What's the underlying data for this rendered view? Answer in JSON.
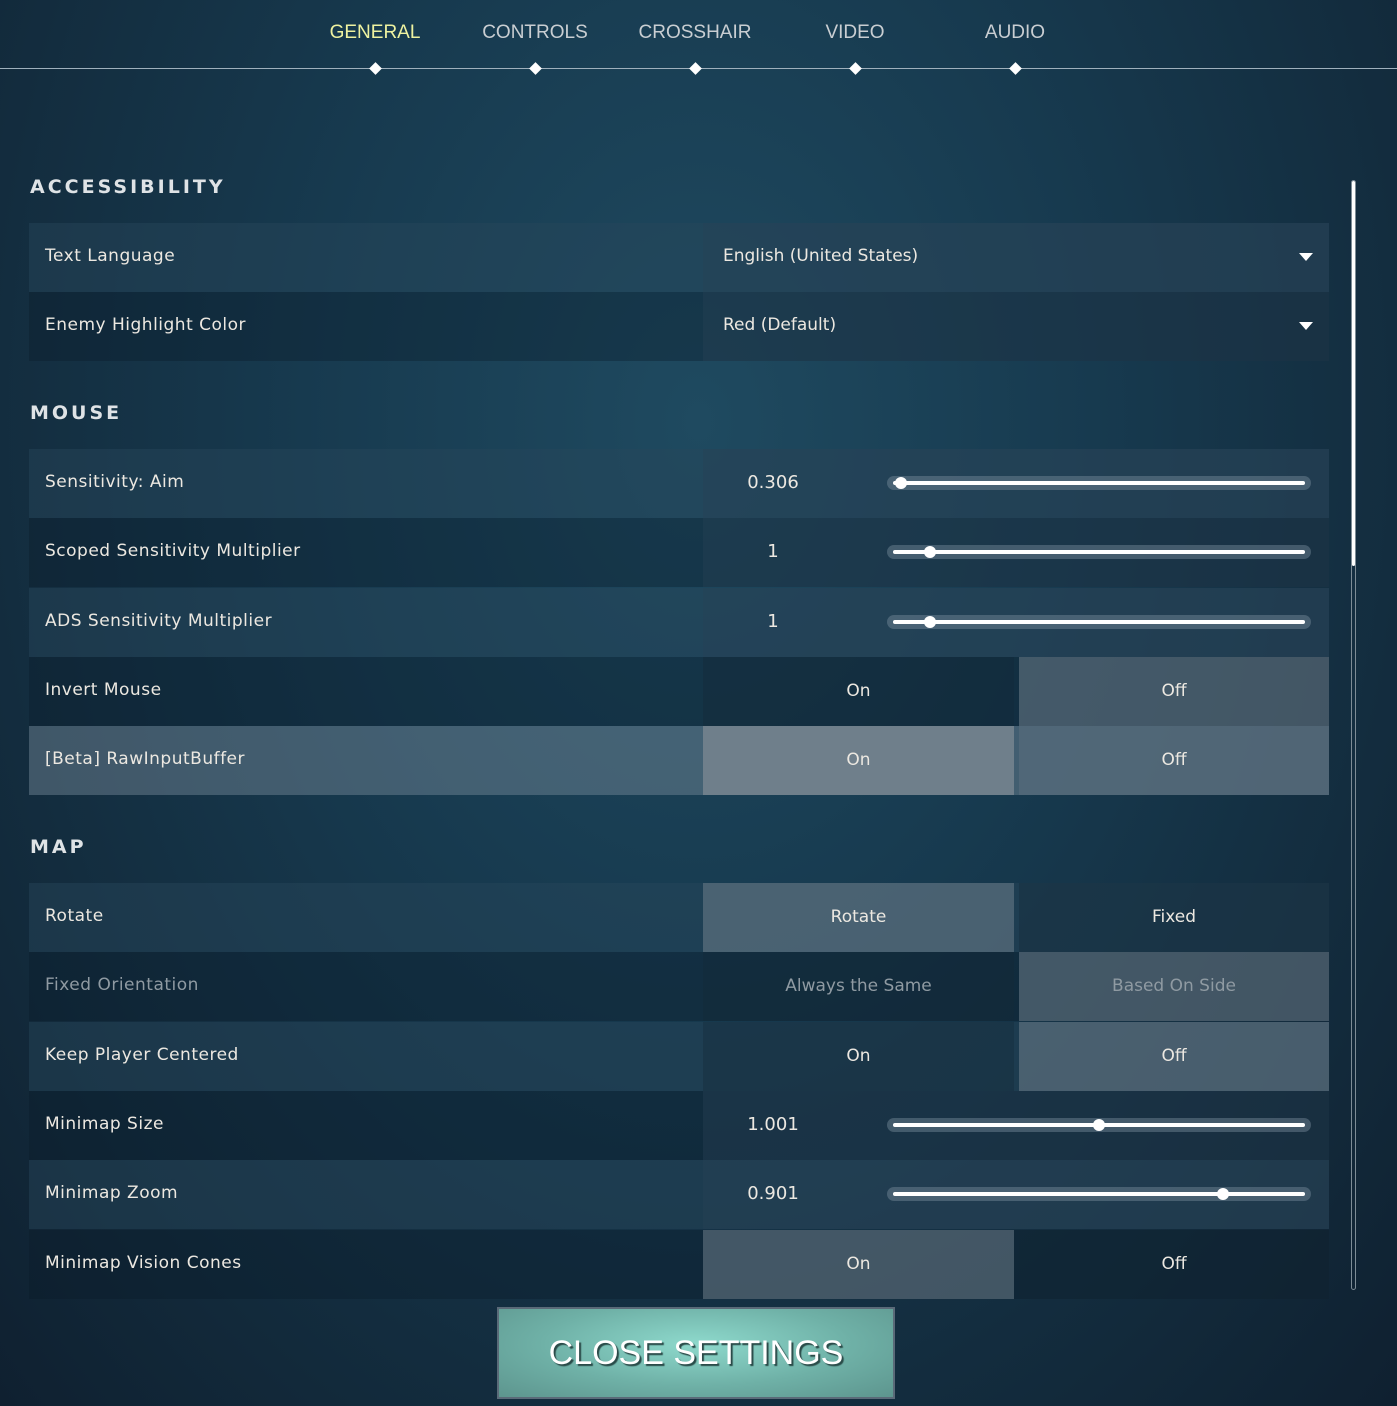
{
  "tabs": [
    "GENERAL",
    "CONTROLS",
    "CROSSHAIR",
    "VIDEO",
    "AUDIO"
  ],
  "active_tab": "GENERAL",
  "sections": [
    {
      "title": "ACCESSIBILITY",
      "rows": [
        {
          "label": "Text Language",
          "type": "dropdown",
          "value": "English (United States)"
        },
        {
          "label": "Enemy Highlight Color",
          "type": "dropdown",
          "value": "Red (Default)"
        }
      ]
    },
    {
      "title": "MOUSE",
      "rows": [
        {
          "label": "Sensitivity: Aim",
          "type": "slider",
          "value": "0.306",
          "fill_percent": 2
        },
        {
          "label": "Scoped Sensitivity Multiplier",
          "type": "slider",
          "value": "1",
          "fill_percent": 9
        },
        {
          "label": "ADS Sensitivity Multiplier",
          "type": "slider",
          "value": "1",
          "fill_percent": 9
        },
        {
          "label": "Invert Mouse",
          "type": "toggle",
          "options": [
            "On",
            "Off"
          ],
          "selected": "Off"
        },
        {
          "label": "[Beta] RawInputBuffer",
          "type": "toggle",
          "options": [
            "On",
            "Off"
          ],
          "selected": "On",
          "hovered": true
        }
      ]
    },
    {
      "title": "MAP",
      "rows": [
        {
          "label": "Rotate",
          "type": "toggle",
          "options": [
            "Rotate",
            "Fixed"
          ],
          "selected": "Rotate"
        },
        {
          "label": "Fixed Orientation",
          "type": "toggle",
          "options": [
            "Always the Same",
            "Based On Side"
          ],
          "selected": "Based On Side",
          "disabled": true
        },
        {
          "label": "Keep Player Centered",
          "type": "toggle",
          "options": [
            "On",
            "Off"
          ],
          "selected": "Off"
        },
        {
          "label": "Minimap Size",
          "type": "slider",
          "value": "1.001",
          "fill_percent": 50
        },
        {
          "label": "Minimap Zoom",
          "type": "slider",
          "value": "0.901",
          "fill_percent": 80
        },
        {
          "label": "Minimap Vision Cones",
          "type": "toggle",
          "options": [
            "On",
            "Off"
          ],
          "selected": "On"
        }
      ]
    }
  ],
  "close_button": "CLOSE SETTINGS",
  "colors": {
    "active_tab": "#eef2a0",
    "close_button": "#7cc4b9"
  }
}
